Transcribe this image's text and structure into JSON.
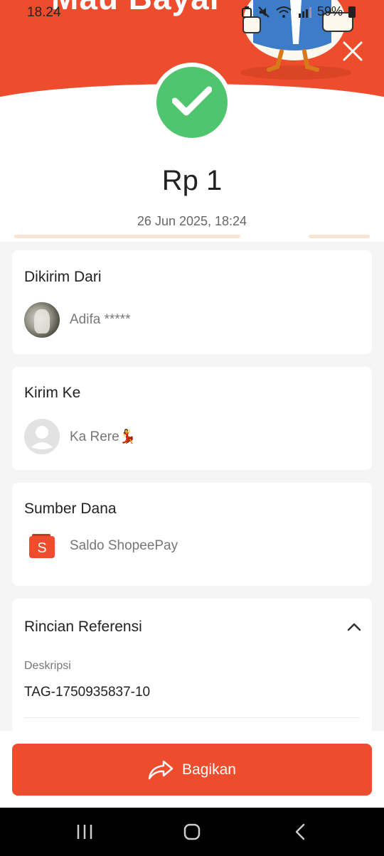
{
  "status_bar": {
    "time": "18.24",
    "battery": "59%"
  },
  "banner": {
    "text": "Mau Bayar"
  },
  "transaction": {
    "amount": "Rp 1",
    "datetime": "26 Jun 2025, 18:24"
  },
  "sender": {
    "title": "Dikirim Dari",
    "name": "Adifa *****"
  },
  "recipient": {
    "title": "Kirim Ke",
    "name": "Ka Rere💃"
  },
  "source": {
    "title": "Sumber Dana",
    "name": "Saldo ShopeePay",
    "icon_letter": "S"
  },
  "reference": {
    "title": "Rincian Referensi",
    "description_label": "Deskripsi",
    "description_value": "TAG-1750935837-10"
  },
  "actions": {
    "share_label": "Bagikan"
  },
  "colors": {
    "brand": "#ee4d2d",
    "success": "#4fc56f"
  }
}
